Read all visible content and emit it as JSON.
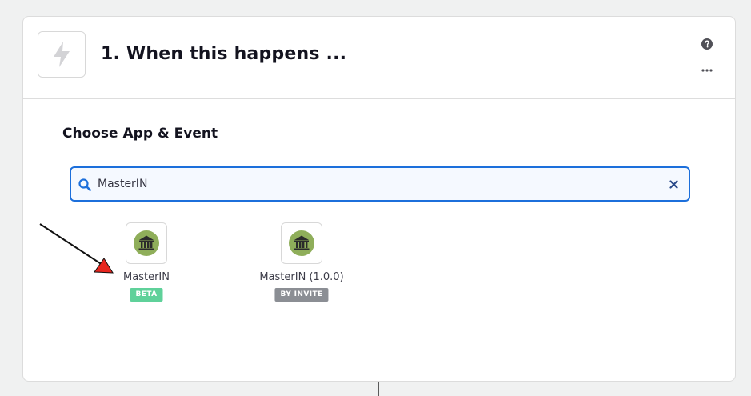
{
  "step": {
    "title": "1. When this happens ...",
    "trigger_icon": "lightning-bolt-icon"
  },
  "header_actions": {
    "help_icon": "question-circle-icon",
    "more_icon": "ellipsis-icon"
  },
  "section": {
    "title": "Choose App & Event"
  },
  "search": {
    "value": "MasterIN",
    "icon": "search-icon",
    "clear_icon": "close-icon"
  },
  "apps": [
    {
      "name": "MasterIN",
      "badge": "BETA",
      "badge_color": "#5fd19a",
      "logo_icon": "bank-building-icon"
    },
    {
      "name": "MasterIN (1.0.0)",
      "badge": "BY INVITE",
      "badge_color": "#8b8e94",
      "logo_icon": "bank-building-icon"
    }
  ],
  "annotation": {
    "arrow_color": "#e8261e"
  },
  "colors": {
    "accent": "#1c6fdb",
    "logo_circle": "#8fae5a"
  }
}
